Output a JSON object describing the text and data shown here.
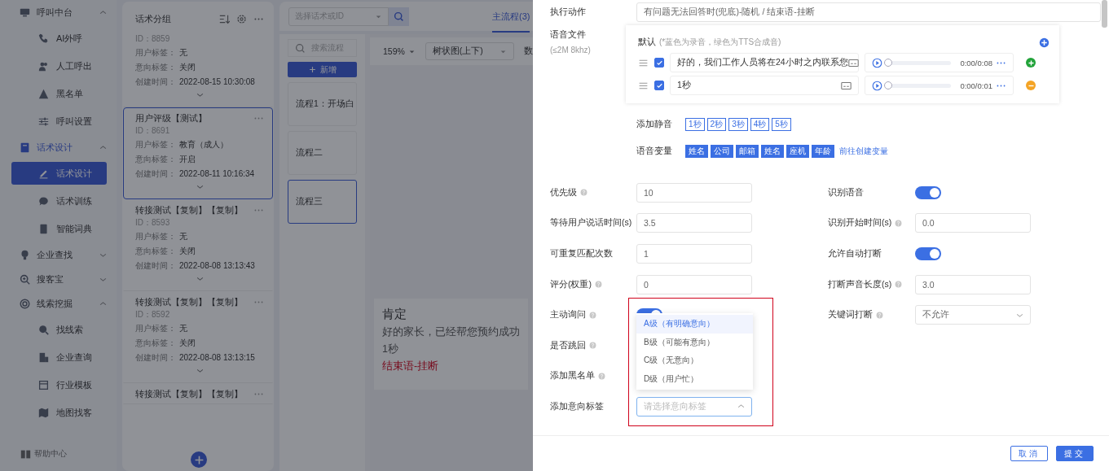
{
  "sidebar": {
    "groups": [
      {
        "label": "呼叫中台",
        "expanded": true,
        "selected": false,
        "children": [
          {
            "label": "AI外呼",
            "selected": false
          },
          {
            "label": "人工呼出",
            "selected": false
          },
          {
            "label": "黑名单",
            "selected": false
          },
          {
            "label": "呼叫设置",
            "selected": false
          }
        ]
      },
      {
        "label": "话术设计",
        "expanded": true,
        "selected": true,
        "children": [
          {
            "label": "话术设计",
            "selected": true
          },
          {
            "label": "话术训练",
            "selected": false
          },
          {
            "label": "智能词典",
            "selected": false
          }
        ]
      },
      {
        "label": "企业查找",
        "expanded": false,
        "selected": false
      },
      {
        "label": "搜客宝",
        "expanded": false,
        "selected": false
      },
      {
        "label": "线索挖掘",
        "expanded": true,
        "selected": false,
        "children": [
          {
            "label": "找线索",
            "selected": false
          },
          {
            "label": "企业查询",
            "selected": false
          },
          {
            "label": "行业模板",
            "selected": false
          },
          {
            "label": "地图找客",
            "selected": false
          }
        ]
      }
    ],
    "help": "帮助中心"
  },
  "groups_panel": {
    "title": "话术分组",
    "cards": [
      {
        "id": "ID：8859",
        "fields": [
          {
            "label": "用户标签：",
            "value": "无"
          },
          {
            "label": "意向标签：",
            "value": "关闭"
          },
          {
            "label": "创建时间：",
            "value": "2022-08-15 10:30:08"
          }
        ],
        "selected": false
      },
      {
        "title": "用户评级【测试】",
        "id": "ID：8691",
        "fields": [
          {
            "label": "用户标签：",
            "value": "教育（成人）"
          },
          {
            "label": "意向标签：",
            "value": "开启"
          },
          {
            "label": "创建时间：",
            "value": "2022-08-11 10:16:34"
          }
        ],
        "selected": true
      },
      {
        "title": "转接测试【复制】【复制】",
        "id": "ID：8593",
        "fields": [
          {
            "label": "用户标签：",
            "value": "无"
          },
          {
            "label": "意向标签：",
            "value": "关闭"
          },
          {
            "label": "创建时间：",
            "value": "2022-08-08 13:13:43"
          }
        ],
        "selected": false
      },
      {
        "title": "转接测试【复制】【复制】",
        "id": "ID：8592",
        "fields": [
          {
            "label": "用户标签：",
            "value": "无"
          },
          {
            "label": "意向标签：",
            "value": "关闭"
          },
          {
            "label": "创建时间：",
            "value": "2022-08-08 13:13:15"
          }
        ],
        "selected": false
      },
      {
        "title": "转接测试【复制】【复制】",
        "selected": false
      }
    ]
  },
  "flow_panel": {
    "script_select": {
      "placeholder": "选择话术或ID"
    },
    "tabs": [
      {
        "label": "主流程(3)",
        "selected": true
      }
    ],
    "flow_search": {
      "placeholder": "搜索流程"
    },
    "add_button": "新增",
    "flows": [
      {
        "label": "流程1：开场白",
        "selected": false
      },
      {
        "label": "流程二",
        "selected": false
      },
      {
        "label": "流程三",
        "selected": true
      }
    ],
    "zoom": "159%",
    "layout_select": "树状图(上下)",
    "toolbar_column_3": "数",
    "node": {
      "title": "肯定",
      "text": "好的家长，已经帮您预约成功",
      "pause": "1秒",
      "action": "结束语-挂断"
    }
  },
  "drawer": {
    "action": {
      "label": "执行动作",
      "value": "有问题无法回答时(兜底)-随机 / 结束语-挂断"
    },
    "voice": {
      "label": "语音文件",
      "hint": "(≤2M 8khz)",
      "default_label": "默认",
      "note": "(*蓝色为录音，绿色为TTS合成音)",
      "rows": [
        {
          "text": "好的，我们工作人员将在24小时之内联系您",
          "checked": true,
          "level": 0,
          "time": "0:00/0:08",
          "kind": "add"
        },
        {
          "text": "1秒",
          "checked": true,
          "level": 0,
          "time": "0:00/0:01",
          "kind": "remove"
        }
      ]
    },
    "silence": {
      "label": "添加静音",
      "options": [
        "1秒",
        "2秒",
        "3秒",
        "4秒",
        "5秒"
      ]
    },
    "variables": {
      "label": "语音变量",
      "tags": [
        "姓名",
        "公司",
        "邮箱",
        "姓名",
        "座机",
        "年龄"
      ],
      "link": "前往创建变量"
    },
    "form_rows": [
      [
        {
          "label": "优先级",
          "help": true,
          "kind": "input",
          "value": "10"
        },
        {
          "label": "识别语音",
          "help": false,
          "kind": "switch",
          "on": true
        }
      ],
      [
        {
          "label": "等待用户说话时间(s)",
          "help": false,
          "kind": "input",
          "value": "3.5"
        },
        {
          "label": "识别开始时间(s)",
          "help": true,
          "kind": "input",
          "value": "0.0"
        }
      ],
      [
        {
          "label": "可重复匹配次数",
          "help": false,
          "kind": "input",
          "value": "1"
        },
        {
          "label": "允许自动打断",
          "help": false,
          "kind": "switch",
          "on": true
        }
      ],
      [
        {
          "label": "评分(权重)",
          "help": true,
          "kind": "input",
          "value": "0"
        },
        {
          "label": "打断声音长度(s)",
          "help": true,
          "kind": "input",
          "value": "3.0"
        }
      ],
      [
        {
          "label": "主动询问",
          "help": true,
          "kind": "switch",
          "on": true
        },
        {
          "label": "关键词打断",
          "help": true,
          "kind": "select",
          "value": "不允许"
        }
      ],
      [
        {
          "label": "是否跳回",
          "help": true,
          "kind": "none"
        }
      ],
      [
        {
          "label": "添加黑名单",
          "help": true,
          "kind": "none"
        }
      ],
      [
        {
          "label": "添加意向标签",
          "help": false,
          "kind": "select",
          "placeholder": "请选择意向标签",
          "expanded": true
        }
      ]
    ],
    "dropdown": [
      {
        "label": "A级（有明确意向）",
        "selected": true
      },
      {
        "label": "B级（可能有意向）",
        "selected": false
      },
      {
        "label": "C级（无意向）",
        "selected": false
      },
      {
        "label": "D级（用户忙）",
        "selected": false
      }
    ],
    "buttons": [
      {
        "label": "取消",
        "kind": "secondary"
      },
      {
        "label": "提交",
        "kind": "primary"
      }
    ]
  }
}
